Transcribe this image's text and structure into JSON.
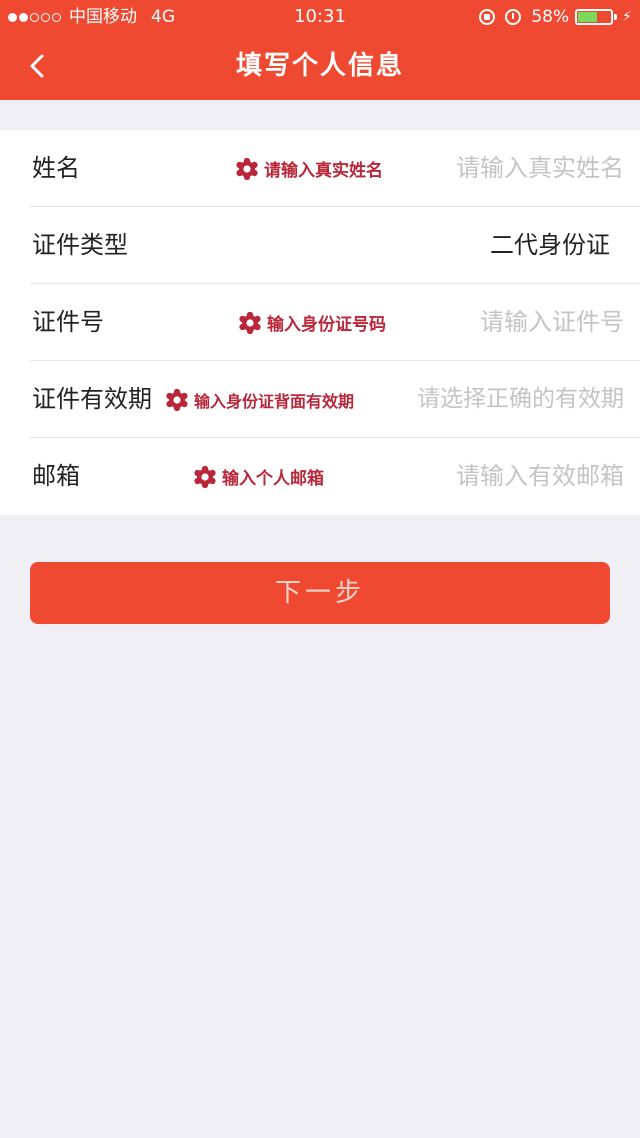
{
  "status_bar": {
    "carrier": "中国移动",
    "network": "4G",
    "time": "10:31",
    "battery_percent": "58%",
    "battery_level": 0.58
  },
  "nav": {
    "title": "填写个人信息",
    "back_icon": "chevron-left-icon"
  },
  "form": {
    "rows": [
      {
        "label": "姓名",
        "hint": "请输入真实姓名",
        "value": "",
        "placeholder": "请输入真实姓名"
      },
      {
        "label": "证件类型",
        "hint": "",
        "value": "二代身份证",
        "placeholder": ""
      },
      {
        "label": "证件号",
        "hint": "输入身份证号码",
        "value": "",
        "placeholder": "请输入证件号"
      },
      {
        "label": "证件有效期",
        "hint": "输入身份证背面有效期",
        "value": "",
        "placeholder": "请选择正确的有效期"
      },
      {
        "label": "邮箱",
        "hint": "输入个人邮箱",
        "value": "",
        "placeholder": "请输入有效邮箱"
      }
    ]
  },
  "next_button": {
    "label": "下一步"
  },
  "colors": {
    "brand": "#ef4a31",
    "hint": "#b8283a",
    "placeholder": "#c4c4c8",
    "background": "#f0eff5"
  }
}
